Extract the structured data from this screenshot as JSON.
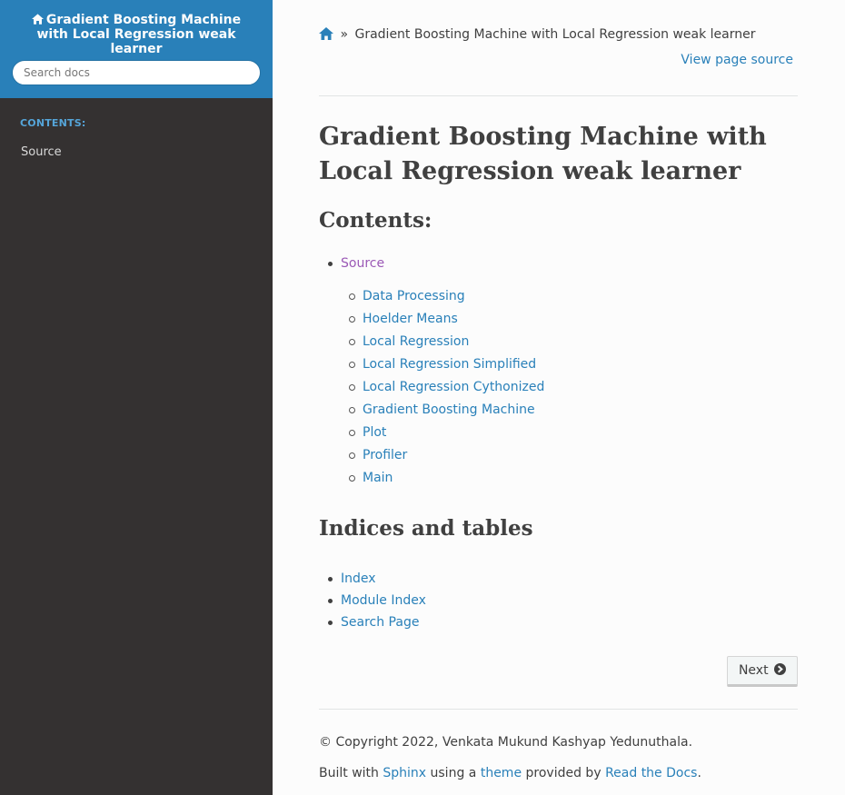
{
  "sidebar": {
    "project_title": "Gradient Boosting Machine with Local Regression weak learner",
    "search_placeholder": "Search docs",
    "caption": "CONTENTS:",
    "items": [
      {
        "label": "Source"
      }
    ]
  },
  "breadcrumbs": {
    "current": "Gradient Boosting Machine with Local Regression weak learner",
    "separator": "»",
    "view_source": "View page source"
  },
  "main": {
    "title": "Gradient Boosting Machine with Local Regression weak learner",
    "contents_heading": "Contents:",
    "toc": {
      "label": "Source",
      "children": [
        "Data Processing",
        "Hoelder Means",
        "Local Regression",
        "Local Regression Simplified",
        "Local Regression Cythonized",
        "Gradient Boosting Machine",
        "Plot",
        "Profiler",
        "Main"
      ]
    },
    "indices_heading": "Indices and tables",
    "indices": [
      "Index",
      "Module Index",
      "Search Page"
    ]
  },
  "footer": {
    "next_label": "Next",
    "copyright": "© Copyright 2022, Venkata Mukund Kashyap Yedunuthala.",
    "built_prefix": "Built with",
    "sphinx": "Sphinx",
    "using_a": "using a",
    "theme": "theme",
    "provided_by": "provided by",
    "rtd": "Read the Docs",
    "period": "."
  },
  "colors": {
    "sidebar_bg": "#343131",
    "sidebar_top": "#2980b9",
    "link": "#2980b9",
    "visited": "#9b59b6",
    "text": "#404040"
  }
}
